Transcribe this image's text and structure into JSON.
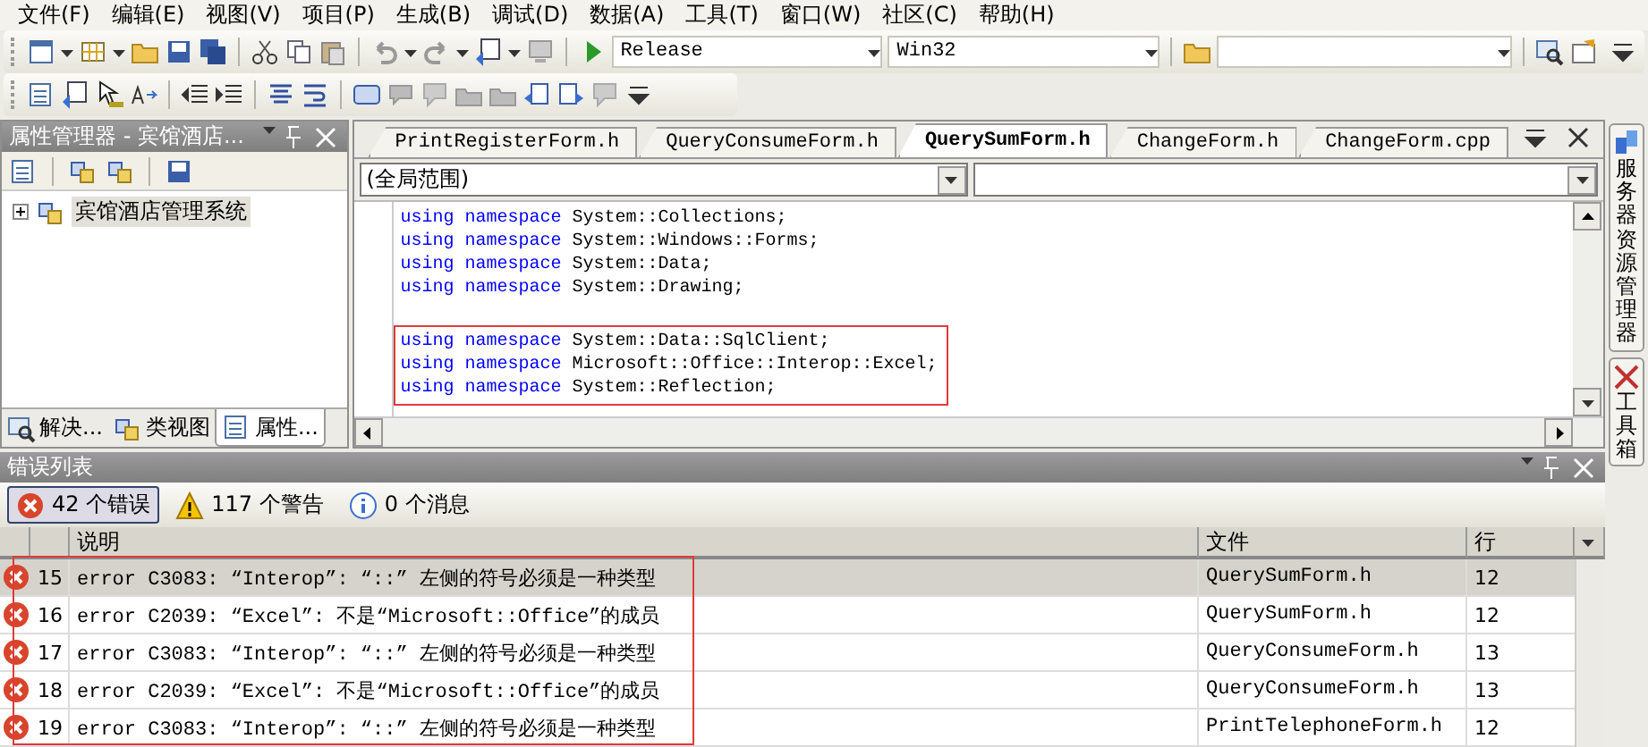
{
  "menu": [
    "文件(F)",
    "编辑(E)",
    "视图(V)",
    "项目(P)",
    "生成(B)",
    "调试(D)",
    "数据(A)",
    "工具(T)",
    "窗口(W)",
    "社区(C)",
    "帮助(H)"
  ],
  "toolbar": {
    "configuration": "Release",
    "platform": "Win32"
  },
  "property_manager": {
    "title": "属性管理器 - 宾馆酒店...",
    "tree": [
      {
        "label": "宾馆酒店管理系统",
        "expanded": false
      }
    ],
    "tabs": [
      {
        "label": "解决...",
        "selected": false
      },
      {
        "label": "类视图",
        "selected": false
      },
      {
        "label": "属性...",
        "selected": true
      }
    ]
  },
  "editor": {
    "tabs": [
      {
        "label": "PrintRegisterForm.h",
        "selected": false
      },
      {
        "label": "QueryConsumeForm.h",
        "selected": false
      },
      {
        "label": "QuerySumForm.h",
        "selected": true
      },
      {
        "label": "ChangeForm.h",
        "selected": false
      },
      {
        "label": "ChangeForm.cpp",
        "selected": false
      }
    ],
    "scope": "(全局范围)",
    "code_blocks": [
      {
        "highlighted": false,
        "lines": [
          {
            "keyword": "using namespace",
            "rest": "System::Collections;"
          },
          {
            "keyword": "using namespace",
            "rest": "System::Windows::Forms;"
          },
          {
            "keyword": "using namespace",
            "rest": "System::Data;"
          },
          {
            "keyword": "using namespace",
            "rest": "System::Drawing;"
          }
        ]
      },
      {
        "highlighted": true,
        "lines": [
          {
            "keyword": "using namespace",
            "rest": "System::Data::SqlClient;"
          },
          {
            "keyword": "using namespace",
            "rest": "Microsoft::Office::Interop::Excel;"
          },
          {
            "keyword": "using namespace",
            "rest": "System::Reflection;"
          }
        ]
      }
    ]
  },
  "side_tabs": [
    "服务器资源管理器",
    "工具箱"
  ],
  "error_list": {
    "title": "错误列表",
    "filters": [
      {
        "kind": "error",
        "label": "42 个错误",
        "selected": true
      },
      {
        "kind": "warning",
        "label": "117 个警告",
        "selected": false
      },
      {
        "kind": "info",
        "label": "0 个消息",
        "selected": false
      }
    ],
    "columns": [
      "说明",
      "文件",
      "行"
    ],
    "highlighted": true,
    "rows": [
      {
        "number": "15",
        "description": "error C3083: “Interop”: “::” 左侧的符号必须是一种类型",
        "file": "QuerySumForm.h",
        "line": "12",
        "selected": true
      },
      {
        "number": "16",
        "description": "error C2039: “Excel”: 不是“Microsoft::Office”的成员",
        "file": "QuerySumForm.h",
        "line": "12",
        "selected": false
      },
      {
        "number": "17",
        "description": "error C3083: “Interop”: “::” 左侧的符号必须是一种类型",
        "file": "QueryConsumeForm.h",
        "line": "13",
        "selected": false
      },
      {
        "number": "18",
        "description": "error C2039: “Excel”: 不是“Microsoft::Office”的成员",
        "file": "QueryConsumeForm.h",
        "line": "13",
        "selected": false
      },
      {
        "number": "19",
        "description": "error C3083: “Interop”: “::” 左侧的符号必须是一种类型",
        "file": "PrintTelephoneForm.h",
        "line": "12",
        "selected": false
      }
    ]
  }
}
